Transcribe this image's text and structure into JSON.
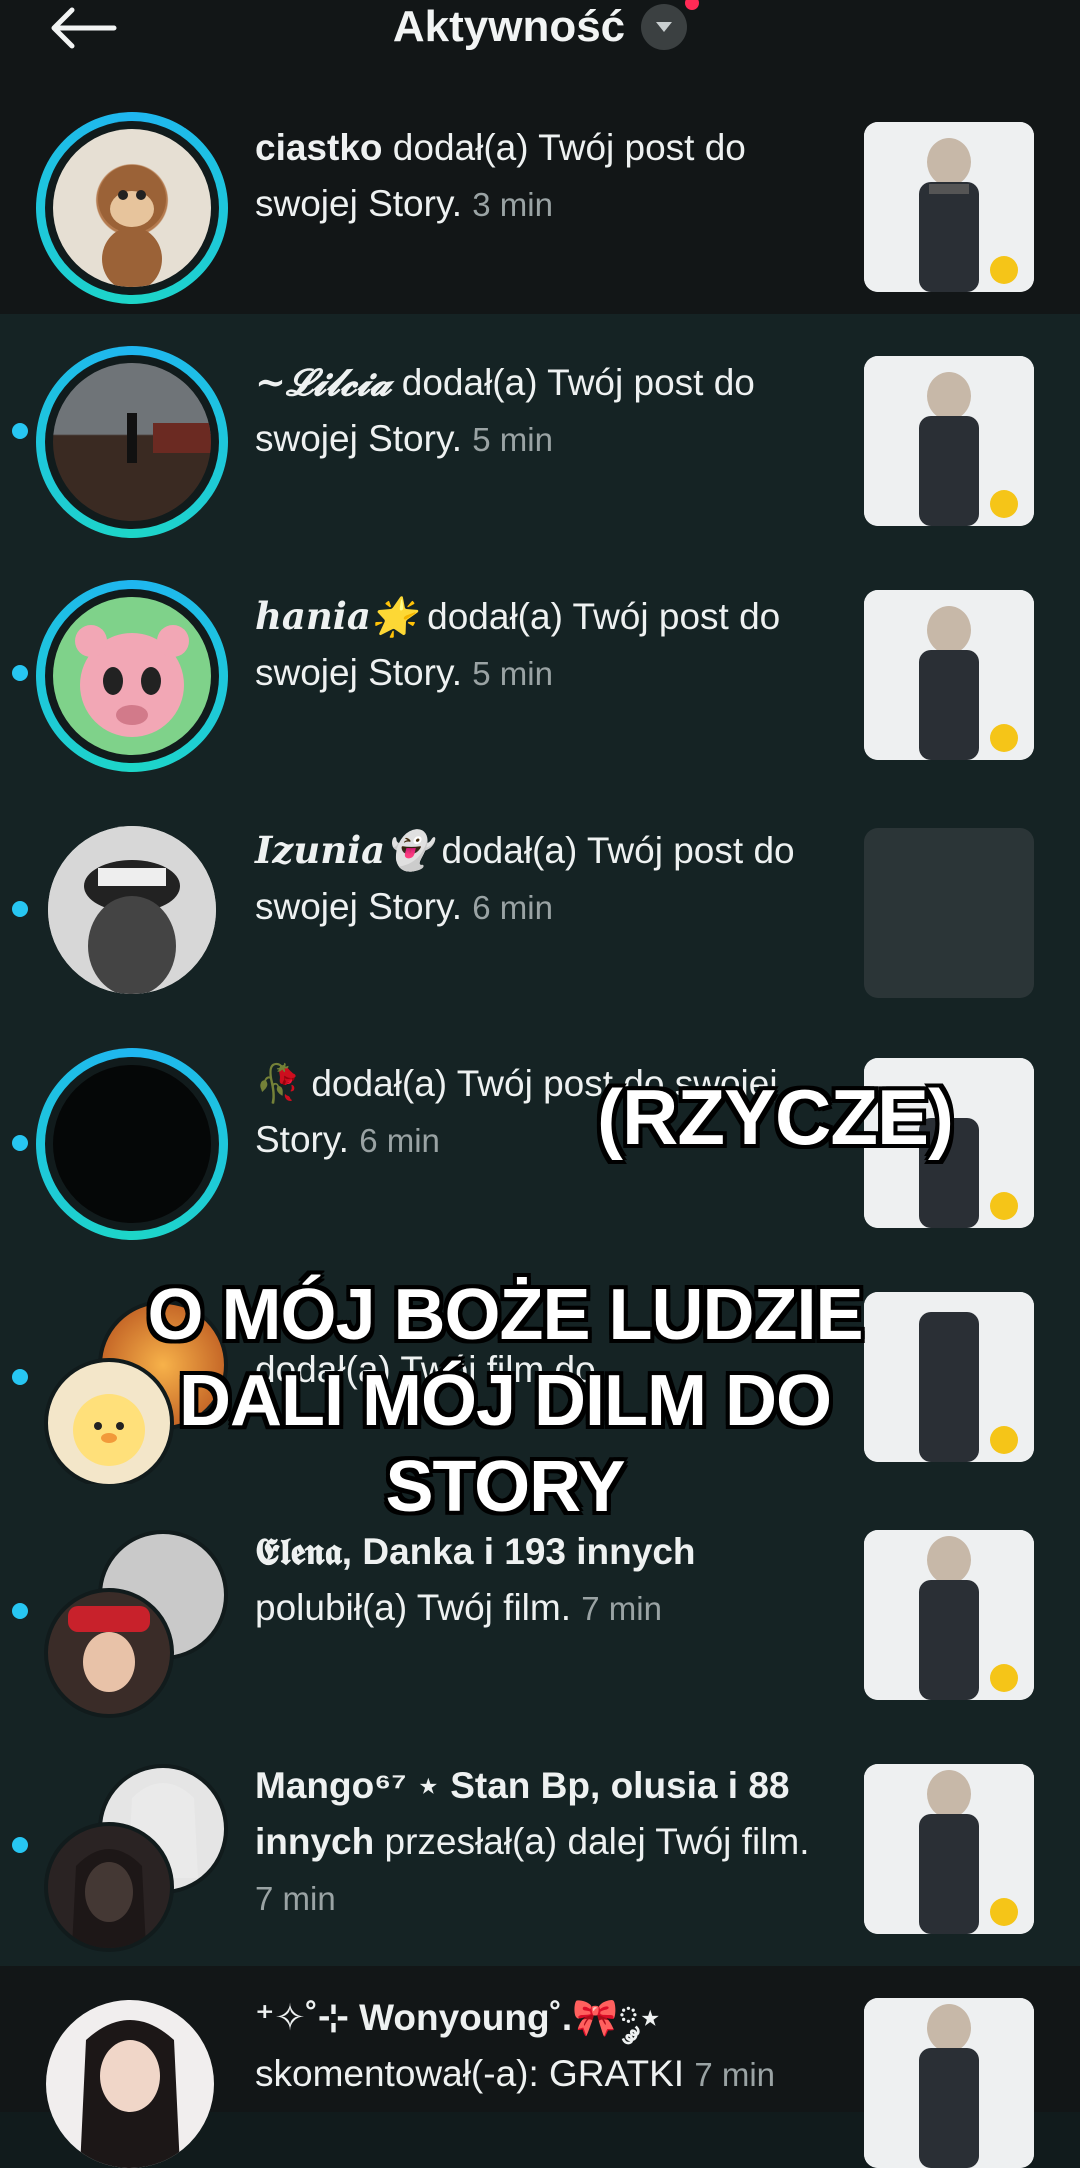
{
  "header": {
    "title": "Aktywność"
  },
  "colors": {
    "accent": "#27c6f2",
    "ring_start": "#1fb6f0",
    "ring_end": "#1dd6c8",
    "notification": "#ff2a55"
  },
  "icons": {
    "back": "arrow-left-icon",
    "dropdown": "chevron-down-icon"
  },
  "items": [
    {
      "name": "ciastko",
      "action": " dodał(a) Twój post do swojej Story.",
      "time": "3 min"
    },
    {
      "name": "~𝓛𝓲𝓵𝓬𝓲𝓪",
      "action": " dodał(a) Twój post do swojej Story.",
      "time": "5 min"
    },
    {
      "name": "hania🌟",
      "action": " dodał(a) Twój post do swojej Story.",
      "time": "5 min"
    },
    {
      "name": "Izunia👻",
      "action": " dodał(a) Twój post do swojej Story.",
      "time": "6 min"
    },
    {
      "name": "🥀",
      "action": " dodał(a) Twój post do swojej Story.",
      "time": "6 min"
    },
    {
      "name": "",
      "action": "dodał(a) Twój film do",
      "time": ""
    },
    {
      "name": "𝕰𝖑𝖊𝖓𝖆, Danka i 193 innych",
      "action": "polubił(a) Twój film.",
      "time": "7 min"
    },
    {
      "name": "Mango⁶⁷ ⋆ Stan Bp, olusia i 88 innych",
      "action": " przesłał(a) dalej Twój film.",
      "time": "7 min"
    },
    {
      "name": "⁺✧˚⊹ Wonyoung˚.🎀༘⋆",
      "action": "skomentował(-a): GRATKI",
      "time": "7 min"
    }
  ],
  "overlay": {
    "top": "(RZYCZE)",
    "main": "O MÓJ BOŻE LUDZIE DALI MÓJ DILM DO STORY"
  }
}
